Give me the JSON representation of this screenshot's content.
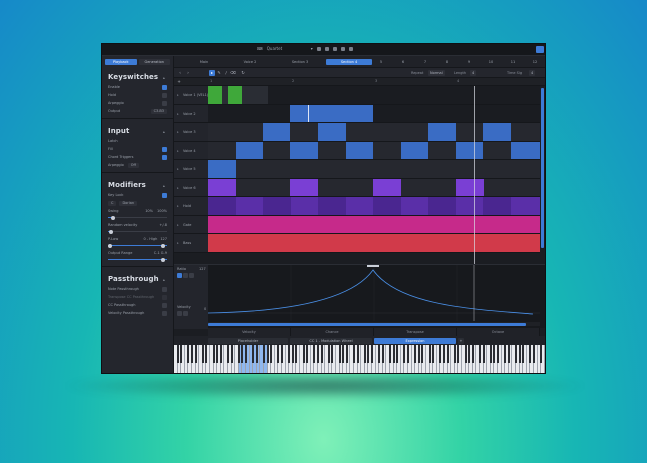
{
  "titlebar": {
    "title": "Quartet",
    "icons": [
      "keyboard-icon",
      "chevron-down-icon",
      "menu-icon",
      "grid-icon",
      "sliders-icon",
      "settings-icon",
      "layout-icon"
    ],
    "corner_button_icon": "panel-icon"
  },
  "sidebar": {
    "tabs": [
      {
        "label": "Playback",
        "active": true
      },
      {
        "label": "Generation",
        "active": false
      }
    ],
    "sections": {
      "keyswitches": {
        "title": "Keyswitches",
        "rows": [
          {
            "label": "Enable",
            "checked": true
          },
          {
            "label": "Hold",
            "checked": false
          },
          {
            "label": "Arpeggio",
            "checked": false
          }
        ],
        "output": {
          "label": "Output",
          "value": "C3-B3"
        }
      },
      "input": {
        "title": "Input",
        "rows": [
          {
            "label": "Latch",
            "checked": false
          },
          {
            "label": "Fill",
            "checked": true
          },
          {
            "label": "Chord Triggers",
            "checked": true
          }
        ],
        "arpeggio": {
          "label": "Arpeggio",
          "value": "Off"
        }
      },
      "modifiers": {
        "title": "Modifiers",
        "key_lock": {
          "label": "Key Lock",
          "checked": true
        },
        "scale": {
          "root": "C",
          "mode": "Dorian"
        },
        "swing": {
          "label": "Swing",
          "value": "10%",
          "value2": "100%",
          "fraction": 0.1
        },
        "random_velocity": {
          "label": "Random velocity",
          "value": "+/-8",
          "fraction": 0.05
        },
        "pitch": {
          "label": "P-Low",
          "low": "0 - High",
          "high": "127",
          "fraction": 0.0
        },
        "output_range": {
          "label": "Output Range",
          "value": "C-1 G-9",
          "fraction": 1.0
        }
      },
      "passthrough": {
        "title": "Passthrough",
        "rows": [
          {
            "label": "Note Passthrough",
            "checked": false
          },
          {
            "label": "Transpose CC Passthrough",
            "checked": false
          },
          {
            "label": "CC Passthrough",
            "checked": false
          },
          {
            "label": "Velocity Passthrough",
            "checked": false
          }
        ]
      }
    }
  },
  "tabs": [
    {
      "label": "Main",
      "active": false
    },
    {
      "label": "Voice 2",
      "active": false
    },
    {
      "label": "Section 3",
      "active": false
    },
    {
      "label": "Section 4",
      "active": true
    },
    {
      "label": "5",
      "active": false
    },
    {
      "label": "6",
      "active": false
    },
    {
      "label": "7",
      "active": false
    },
    {
      "label": "8",
      "active": false
    },
    {
      "label": "9",
      "active": false
    },
    {
      "label": "10",
      "active": false
    },
    {
      "label": "11",
      "active": false
    },
    {
      "label": "12",
      "active": false
    }
  ],
  "toolbar": {
    "pattern_label": "Repeat",
    "pattern_value": "Normal",
    "length_label": "Length",
    "length_value": "4",
    "time_sig_label": "Time Sig",
    "time_sig_value": "4"
  },
  "ruler": [
    "1",
    "2",
    "3",
    "4"
  ],
  "tracks": [
    {
      "name": "Voice 1 (VEL1)",
      "color": "#3fa83a"
    },
    {
      "name": "Voice 2",
      "color": "#3a6cc4"
    },
    {
      "name": "Voice 3",
      "color": "#3a6cc4"
    },
    {
      "name": "Voice 4",
      "color": "#3a6cc4"
    },
    {
      "name": "Voice 5",
      "color": "#3a6cc4"
    },
    {
      "name": "Voice 6",
      "color": "#7a3fd4"
    },
    {
      "name": "Hold",
      "color": "#7a3fd4"
    },
    {
      "name": "Gate",
      "color": "#c62a8a"
    },
    {
      "name": "Bass",
      "color": "#d13a4a"
    }
  ],
  "automation": {
    "title": "Ratio",
    "value_top": "127",
    "value_bottom": "0",
    "param": "Velocity"
  },
  "lane_labels": [
    "Velocity",
    "Chance",
    "Transpose",
    "Octave"
  ],
  "bottom": {
    "left": "Placeholder",
    "mid": "CC 1 - Modulation Wheel",
    "right": "Expression"
  },
  "colors": {
    "accent": "#3d7bd6",
    "green": "#3fa83a",
    "blue": "#3a6cc4",
    "purple": "#7a3fd4",
    "magenta": "#c62a8a",
    "red": "#d13a4a"
  }
}
